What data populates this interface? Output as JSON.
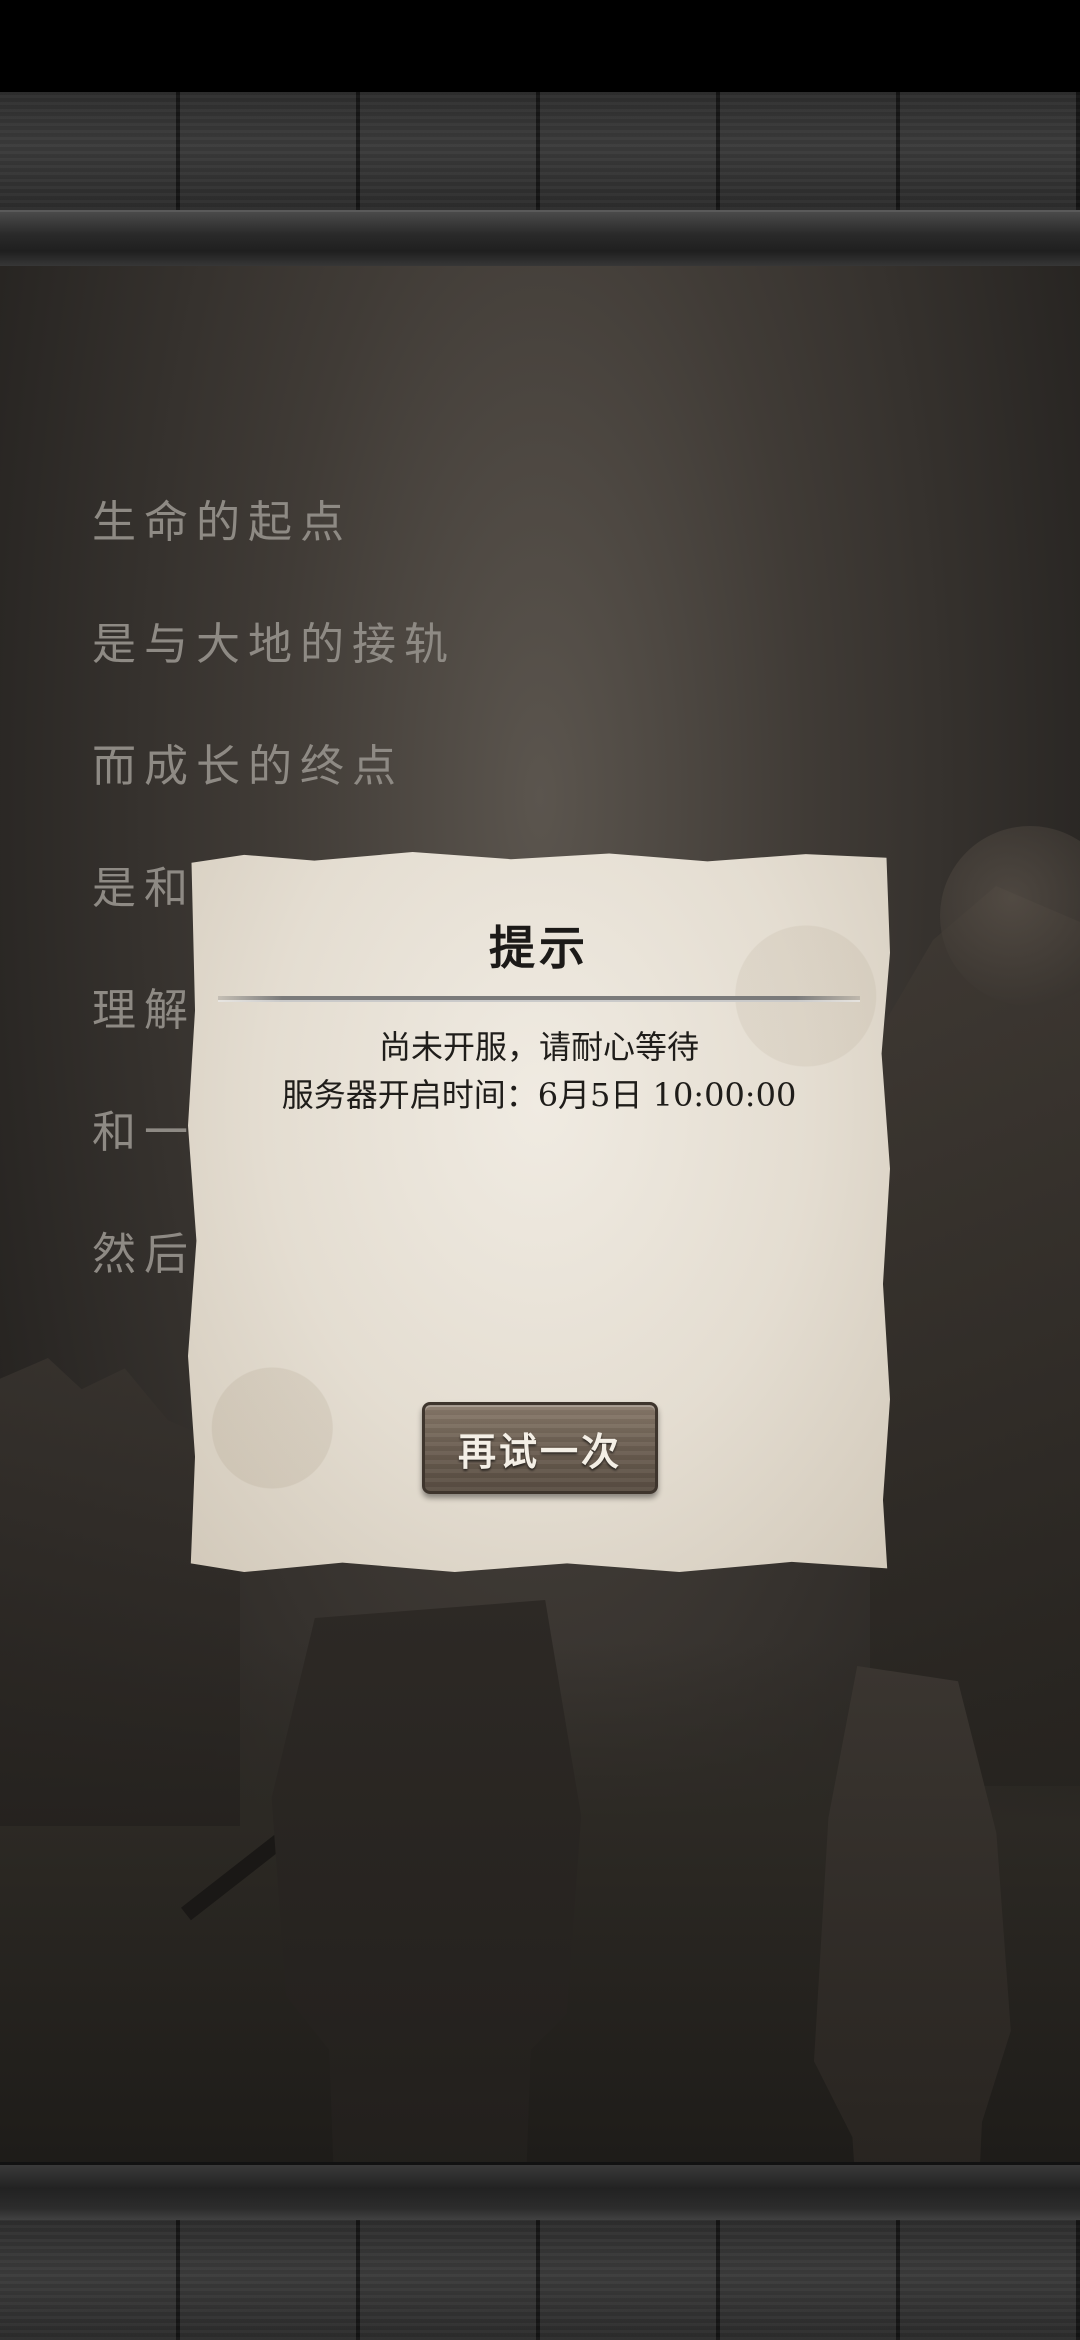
{
  "poem": {
    "lines": [
      "生命的起点",
      "是与大地的接轨",
      "而成长的终点",
      "是和",
      "理解",
      "和一",
      "然后"
    ]
  },
  "dialog": {
    "title": "提示",
    "message_line_1": "尚未开服，请耐心等待",
    "message_line_2": "服务器开启时间：6月5日 10:00:00",
    "retry_button_label": "再试一次"
  },
  "colors": {
    "paper": "#e4ddd1",
    "poem_text": "#8e8a84",
    "button_wood": "#6e6154",
    "frame_wood": "#353535"
  }
}
